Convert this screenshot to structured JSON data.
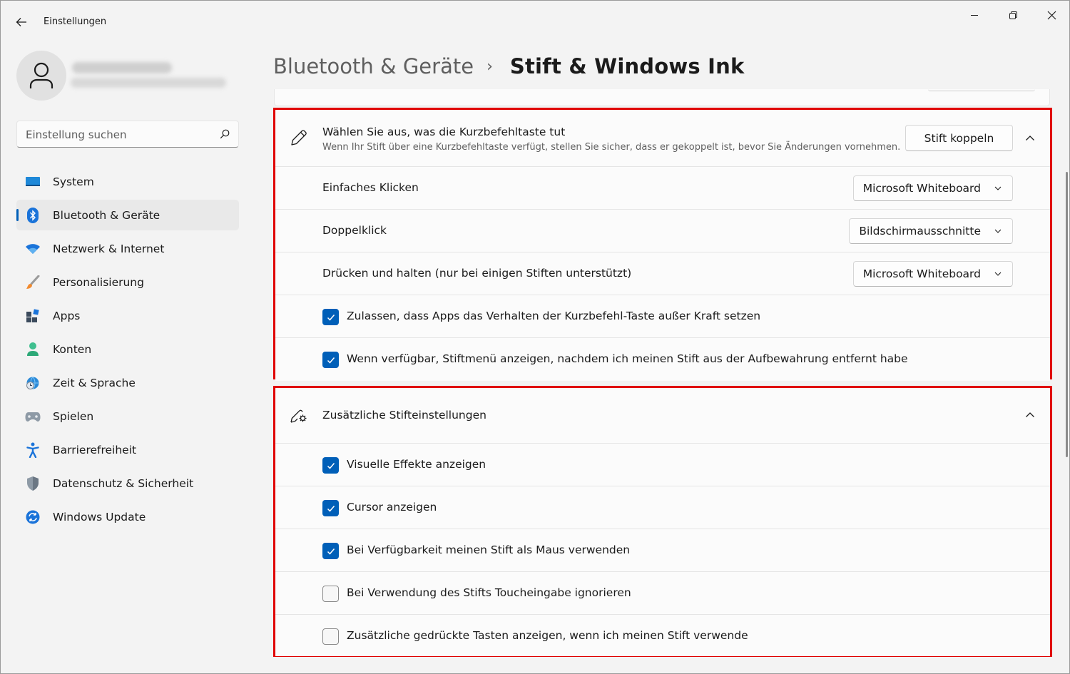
{
  "window": {
    "title": "Einstellungen",
    "controls": [
      "minimize",
      "maximize",
      "close"
    ]
  },
  "sidebar": {
    "search_placeholder": "Einstellung suchen",
    "items": [
      {
        "label": "System",
        "icon": "system-icon"
      },
      {
        "label": "Bluetooth & Geräte",
        "icon": "bluetooth-icon",
        "active": true
      },
      {
        "label": "Netzwerk & Internet",
        "icon": "wifi-icon"
      },
      {
        "label": "Personalisierung",
        "icon": "brush-icon"
      },
      {
        "label": "Apps",
        "icon": "apps-icon"
      },
      {
        "label": "Konten",
        "icon": "account-icon"
      },
      {
        "label": "Zeit & Sprache",
        "icon": "globe-clock-icon"
      },
      {
        "label": "Spielen",
        "icon": "gamepad-icon"
      },
      {
        "label": "Barrierefreiheit",
        "icon": "accessibility-icon"
      },
      {
        "label": "Datenschutz & Sicherheit",
        "icon": "shield-icon"
      },
      {
        "label": "Windows Update",
        "icon": "update-icon"
      }
    ]
  },
  "breadcrumb": {
    "parent": "Bluetooth & Geräte",
    "separator": "›",
    "current": "Stift & Windows Ink"
  },
  "shortcut_section": {
    "title": "Wählen Sie aus, was die Kurzbefehltaste tut",
    "description": "Wenn Ihr Stift über eine Kurzbefehltaste verfügt, stellen Sie sicher, dass er gekoppelt ist, bevor Sie Änderungen vornehmen.",
    "pair_button": "Stift koppeln",
    "rows": [
      {
        "label": "Einfaches Klicken",
        "value": "Microsoft Whiteboard"
      },
      {
        "label": "Doppelklick",
        "value": "Bildschirmausschnitte"
      },
      {
        "label": "Drücken und halten (nur bei einigen Stiften unterstützt)",
        "value": "Microsoft Whiteboard"
      }
    ],
    "checkboxes": [
      {
        "label": "Zulassen, dass Apps das Verhalten der Kurzbefehl-Taste außer Kraft setzen",
        "checked": true
      },
      {
        "label": "Wenn verfügbar, Stiftmenü anzeigen, nachdem ich meinen Stift aus der Aufbewahrung entfernt habe",
        "checked": true
      }
    ]
  },
  "additional_section": {
    "title": "Zusätzliche Stifteinstellungen",
    "checkboxes": [
      {
        "label": "Visuelle Effekte anzeigen",
        "checked": true
      },
      {
        "label": "Cursor anzeigen",
        "checked": true
      },
      {
        "label": "Bei Verfügbarkeit meinen Stift als Maus verwenden",
        "checked": true
      },
      {
        "label": "Bei Verwendung des Stifts Toucheingabe ignorieren",
        "checked": false
      },
      {
        "label": "Zusätzliche gedrückte Tasten anzeigen, wenn ich meinen Stift verwende",
        "checked": false
      }
    ]
  },
  "colors": {
    "accent": "#005fb8",
    "highlight_border": "#e00000",
    "background": "#f3f3f3",
    "card": "#fbfbfb"
  }
}
